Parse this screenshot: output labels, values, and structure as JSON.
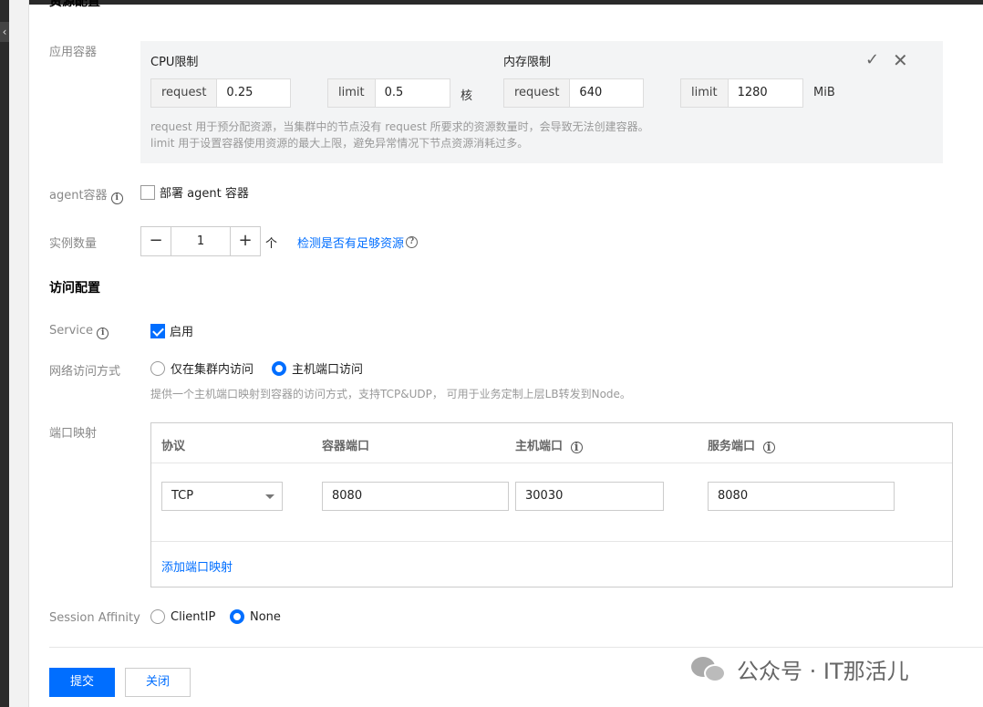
{
  "sections": {
    "resource_title": "资源配置",
    "access_title": "访问配置"
  },
  "container": {
    "label": "应用容器",
    "cpu_title": "CPU限制",
    "mem_title": "内存限制",
    "cpu_request_prefix": "request",
    "cpu_request_value": "0.25",
    "cpu_limit_prefix": "limit",
    "cpu_limit_value": "0.5",
    "cpu_unit": "核",
    "mem_request_prefix": "request",
    "mem_request_value": "640",
    "mem_limit_prefix": "limit",
    "mem_limit_value": "1280",
    "mem_unit": "MiB",
    "hint_line1": "request 用于预分配资源，当集群中的节点没有 request 所要求的资源数量时，会导致无法创建容器。",
    "hint_line2": "limit 用于设置容器使用资源的最大上限，避免异常情况下节点资源消耗过多。"
  },
  "agent": {
    "label": "agent容器",
    "checkbox_label": "部署 agent 容器",
    "checked": false
  },
  "instances": {
    "label": "实例数量",
    "value": "1",
    "unit": "个",
    "check_link": "检测是否有足够资源"
  },
  "service": {
    "label": "Service",
    "checkbox_label": "启用",
    "checked": true
  },
  "network": {
    "label": "网络访问方式",
    "options": [
      "仅在集群内访问",
      "主机端口访问"
    ],
    "selected": "主机端口访问",
    "description": "提供一个主机端口映射到容器的访问方式，支持TCP&UDP， 可用于业务定制上层LB转发到Node。"
  },
  "ports": {
    "label": "端口映射",
    "headers": [
      "协议",
      "容器端口",
      "主机端口",
      "服务端口"
    ],
    "rows": [
      {
        "protocol": "TCP",
        "container_port": "8080",
        "host_port": "30030",
        "service_port": "8080"
      }
    ],
    "add_link": "添加端口映射"
  },
  "session_affinity": {
    "label": "Session Affinity",
    "options": [
      "ClientIP",
      "None"
    ],
    "selected": "None"
  },
  "actions": {
    "submit": "提交",
    "close": "关闭"
  },
  "watermark": {
    "text": "公众号 · IT那活儿"
  },
  "colors": {
    "accent": "#006eff",
    "panel_bg": "#f3f4f5"
  }
}
